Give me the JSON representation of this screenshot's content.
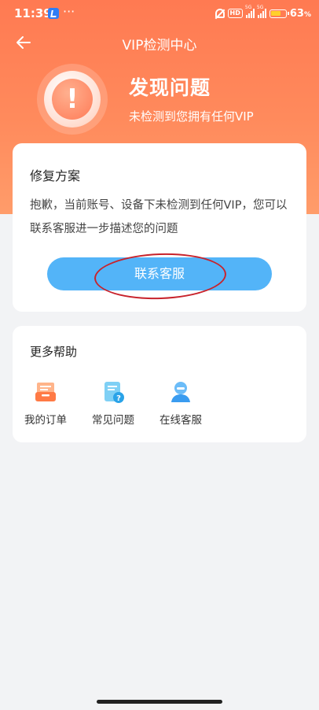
{
  "status_bar": {
    "time": "11:39",
    "dots": "···",
    "hd": "HD",
    "net1": "5G",
    "net2": "5G",
    "battery_pct": "63",
    "battery_unit": "%"
  },
  "nav": {
    "title": "VIP检测中心"
  },
  "result": {
    "icon_glyph": "!",
    "title": "发现问题",
    "subtitle": "未检测到您拥有任何VIP"
  },
  "fix_card": {
    "title": "修复方案",
    "description": "抱歉，当前账号、设备下未检测到任何VIP，您可以联系客服进一步描述您的问题",
    "button_label": "联系客服"
  },
  "help_card": {
    "title": "更多帮助",
    "items": [
      {
        "label": "我的订单",
        "icon": "order-icon"
      },
      {
        "label": "常见问题",
        "icon": "faq-icon"
      },
      {
        "label": "在线客服",
        "icon": "customer-service-icon"
      }
    ]
  },
  "colors": {
    "header_orange": "#ff7a52",
    "button_blue": "#53b4f8",
    "annotation_red": "#c8232c"
  }
}
